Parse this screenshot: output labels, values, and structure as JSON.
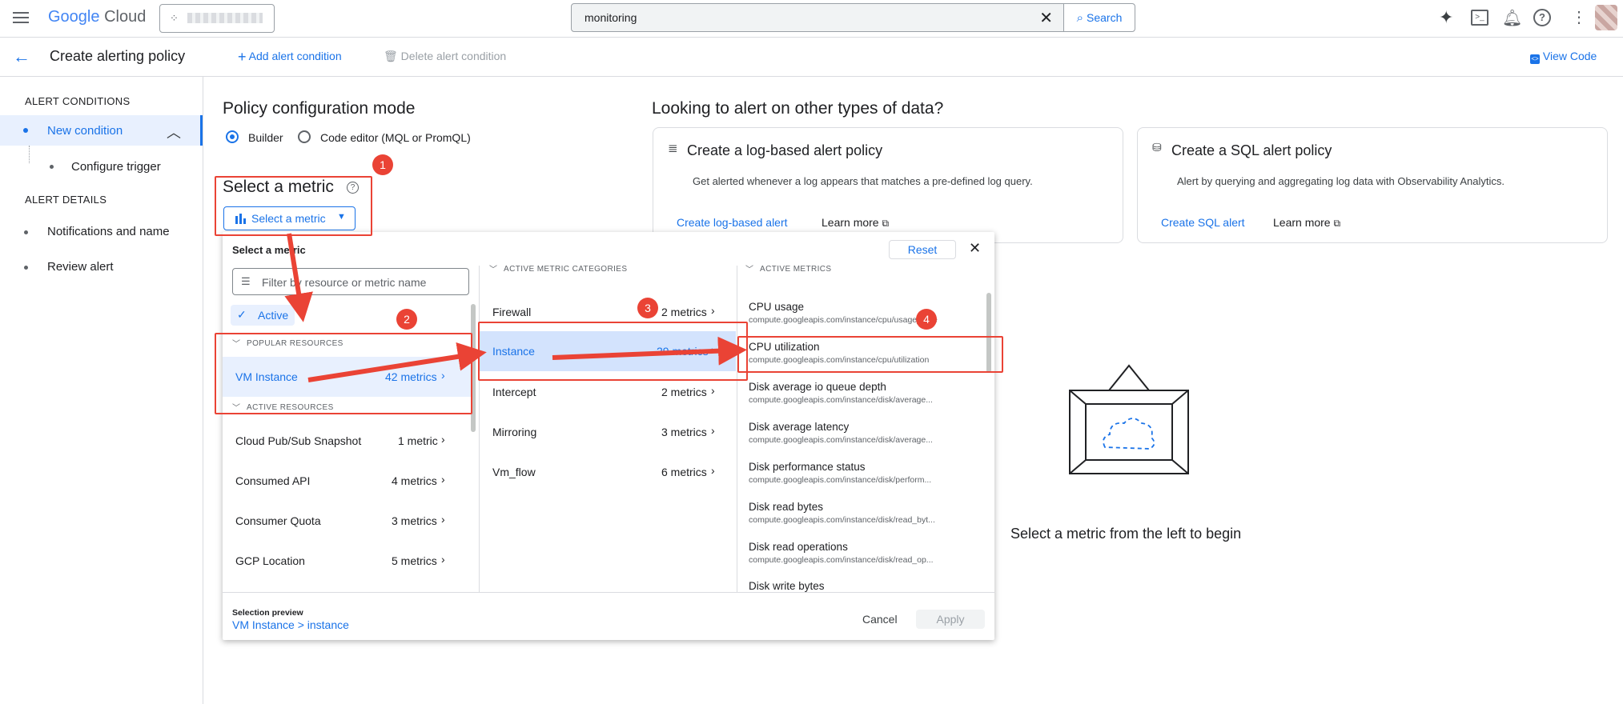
{
  "header": {
    "logo_google": "Google",
    "logo_cloud": "Cloud",
    "search_value": "monitoring",
    "search_button": "Search"
  },
  "toolbar": {
    "title": "Create alerting policy",
    "add_condition": "Add alert condition",
    "delete_condition": "Delete alert condition",
    "view_code": "View Code"
  },
  "sidebar": {
    "alert_conditions": "ALERT CONDITIONS",
    "new_condition": "New condition",
    "configure_trigger": "Configure trigger",
    "alert_details": "ALERT DETAILS",
    "notifications": "Notifications and name",
    "review": "Review alert"
  },
  "policy": {
    "mode_title": "Policy configuration mode",
    "builder": "Builder",
    "code_editor": "Code editor (MQL or PromQL)",
    "select_metric_title": "Select a metric",
    "select_metric_button": "Select a metric"
  },
  "other_types": {
    "title": "Looking to alert on other types of data?",
    "log_card": {
      "title": "Create a log-based alert policy",
      "desc": "Get alerted whenever a log appears that matches a pre-defined log query.",
      "action": "Create log-based alert",
      "learn": "Learn more"
    },
    "sql_card": {
      "title": "Create a SQL alert policy",
      "desc": "Alert by querying and aggregating log data with Observability Analytics.",
      "action": "Create SQL alert",
      "learn": "Learn more"
    }
  },
  "picker": {
    "title": "Select a metric",
    "reset": "Reset",
    "filter_placeholder": "Filter by resource or metric name",
    "active_chip": "Active",
    "popular_header": "POPULAR RESOURCES",
    "active_resources_header": "ACTIVE RESOURCES",
    "resources": [
      {
        "name": "VM Instance",
        "count": "42 metrics"
      },
      {
        "name": "Cloud Pub/Sub Snapshot",
        "count": "1 metric"
      },
      {
        "name": "Consumed API",
        "count": "4 metrics"
      },
      {
        "name": "Consumer Quota",
        "count": "3 metrics"
      },
      {
        "name": "GCP Location",
        "count": "5 metrics"
      }
    ],
    "categories_header": "ACTIVE METRIC CATEGORIES",
    "categories": [
      {
        "name": "Firewall",
        "count": "2 metrics"
      },
      {
        "name": "Instance",
        "count": "29 metrics"
      },
      {
        "name": "Intercept",
        "count": "2 metrics"
      },
      {
        "name": "Mirroring",
        "count": "3 metrics"
      },
      {
        "name": "Vm_flow",
        "count": "6 metrics"
      }
    ],
    "metrics_header": "ACTIVE METRICS",
    "metrics": [
      {
        "name": "CPU usage",
        "path": "compute.googleapis.com/instance/cpu/usage_time"
      },
      {
        "name": "CPU utilization",
        "path": "compute.googleapis.com/instance/cpu/utilization"
      },
      {
        "name": "Disk average io queue depth",
        "path": "compute.googleapis.com/instance/disk/average..."
      },
      {
        "name": "Disk average latency",
        "path": "compute.googleapis.com/instance/disk/average..."
      },
      {
        "name": "Disk performance status",
        "path": "compute.googleapis.com/instance/disk/perform..."
      },
      {
        "name": "Disk read bytes",
        "path": "compute.googleapis.com/instance/disk/read_byt..."
      },
      {
        "name": "Disk read operations",
        "path": "compute.googleapis.com/instance/disk/read_op..."
      },
      {
        "name": "Disk write bytes",
        "path": ""
      }
    ],
    "preview_label": "Selection preview",
    "preview_value": "VM Instance > instance",
    "cancel": "Cancel",
    "apply": "Apply"
  },
  "empty_state": "Select a metric from the left to begin",
  "annotations": [
    "1",
    "2",
    "3",
    "4"
  ]
}
